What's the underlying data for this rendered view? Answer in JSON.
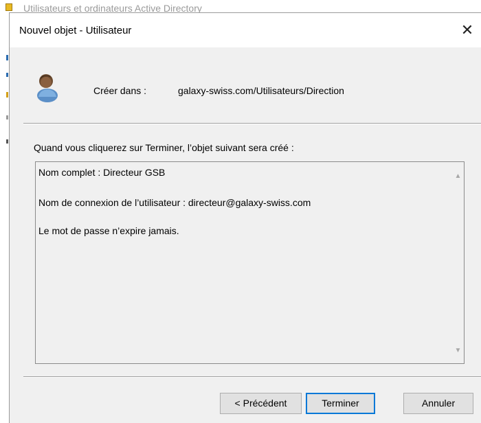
{
  "background_window": {
    "title": "Utilisateurs et ordinateurs Active Directory"
  },
  "dialog": {
    "title": "Nouvel objet - Utilisateur",
    "close_glyph": "✕",
    "create_in_label": "Créer dans :",
    "create_in_path": "galaxy-swiss.com/Utilisateurs/Direction",
    "intro_text": "Quand vous cliquerez sur Terminer, l’objet suivant sera créé :",
    "summary_lines": [
      "Nom complet : Directeur GSB",
      "Nom de connexion de l’utilisateur : directeur@galaxy-swiss.com",
      "Le mot de passe n’expire jamais."
    ],
    "scroll_up_glyph": "▲",
    "scroll_down_glyph": "▼",
    "buttons": {
      "previous": "< Précédent",
      "finish": "Terminer",
      "cancel": "Annuler"
    }
  },
  "icons": {
    "user": "user-icon",
    "close": "close-icon"
  },
  "colors": {
    "dialog_bg": "#f0f0f0",
    "titlebar_bg": "#ffffff",
    "default_button_border": "#0078d7"
  }
}
